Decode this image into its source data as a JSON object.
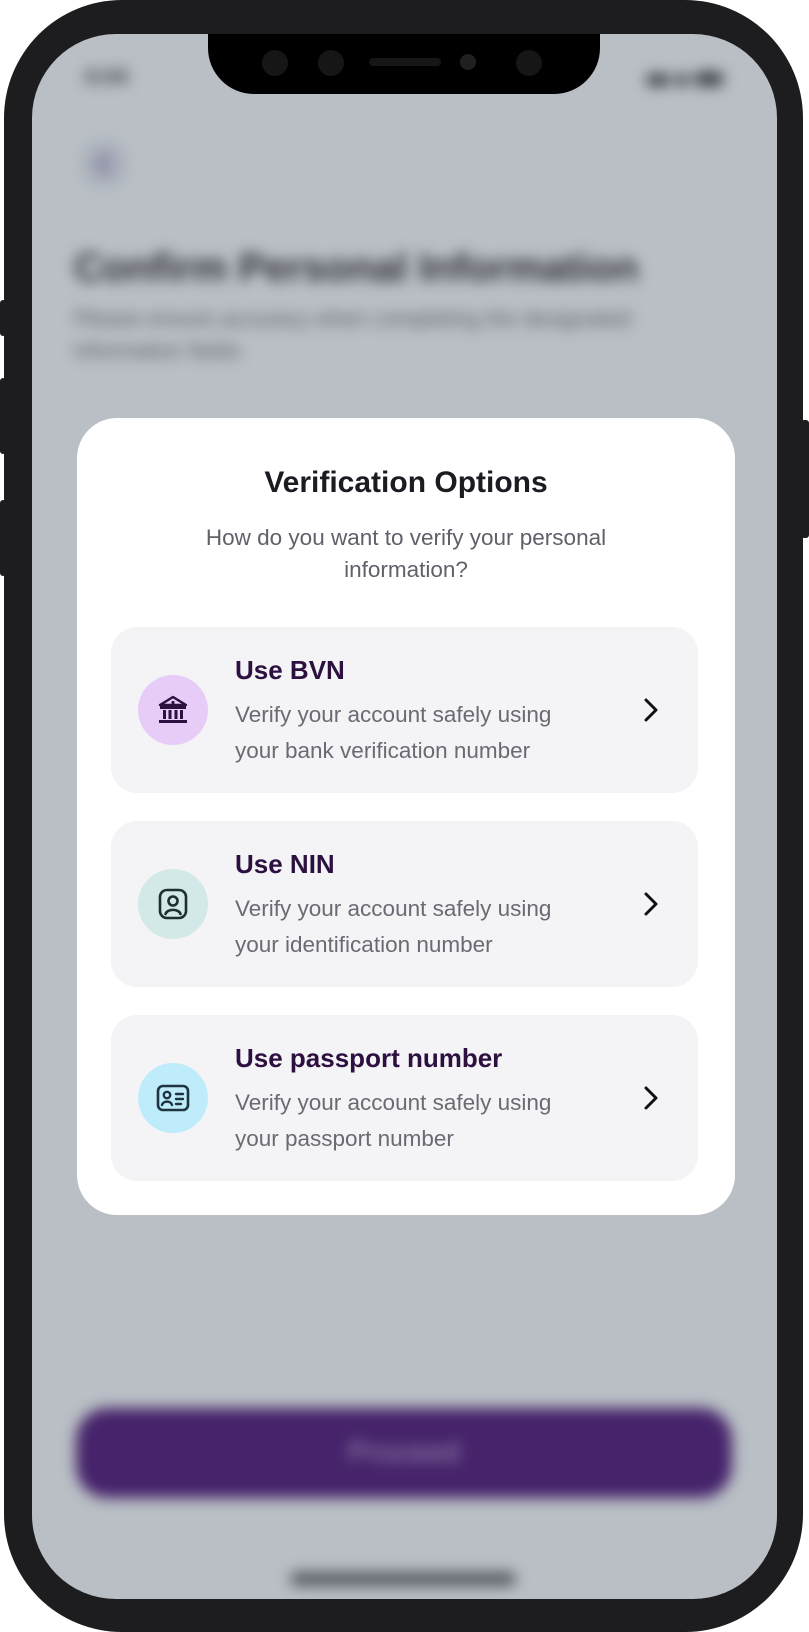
{
  "background": {
    "status_time": "4:04",
    "title": "Confirm Personal Information",
    "subtitle_line1": "Please ensure accuracy when completing the designated",
    "subtitle_line2": "information fields",
    "proceed_label": "Proceed"
  },
  "modal": {
    "title": "Verification Options",
    "subtitle_line1": "How do you want to verify your personal",
    "subtitle_line2": "information?",
    "options": [
      {
        "title": "Use BVN",
        "desc_line1": "Verify your account safely using",
        "desc_line2": "your bank verification number",
        "icon": "bank-icon",
        "icon_bg": "#e7ccf7"
      },
      {
        "title": "Use NIN",
        "desc_line1": "Verify your account safely using",
        "desc_line2": "your identification number",
        "icon": "id-badge-icon",
        "icon_bg": "#d3e9e7"
      },
      {
        "title": "Use passport number",
        "desc_line1": "Verify your account safely using",
        "desc_line2": "your passport number",
        "icon": "id-card-icon",
        "icon_bg": "#bfecfa"
      }
    ]
  },
  "colors": {
    "accent": "#46236a",
    "title_dark": "#2b1040"
  }
}
